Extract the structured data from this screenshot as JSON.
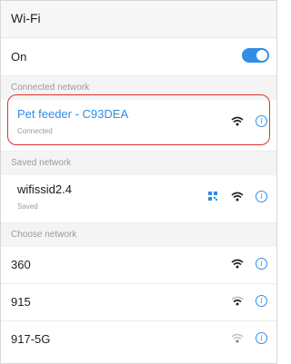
{
  "header": {
    "title": "Wi-Fi"
  },
  "wifi_toggle": {
    "label": "On",
    "state": "on",
    "color": "#2f8ee8"
  },
  "sections": {
    "connected": "Connected network",
    "saved": "Saved network",
    "choose": "Choose network"
  },
  "connected_network": {
    "name": "Pet feeder - C93DEA",
    "status": "Connected",
    "name_color": "#2f8ee8",
    "signal": "strong"
  },
  "saved_networks": [
    {
      "name": "wifissid2.4",
      "status": "Saved",
      "has_qr": true,
      "signal": "medium"
    }
  ],
  "available_networks": [
    {
      "name": "360",
      "signal": "medium"
    },
    {
      "name": "915",
      "signal": "low"
    },
    {
      "name": "917-5G",
      "signal": "weak"
    }
  ],
  "colors": {
    "accent": "#2f8ee8",
    "highlight_border": "#d93232"
  }
}
